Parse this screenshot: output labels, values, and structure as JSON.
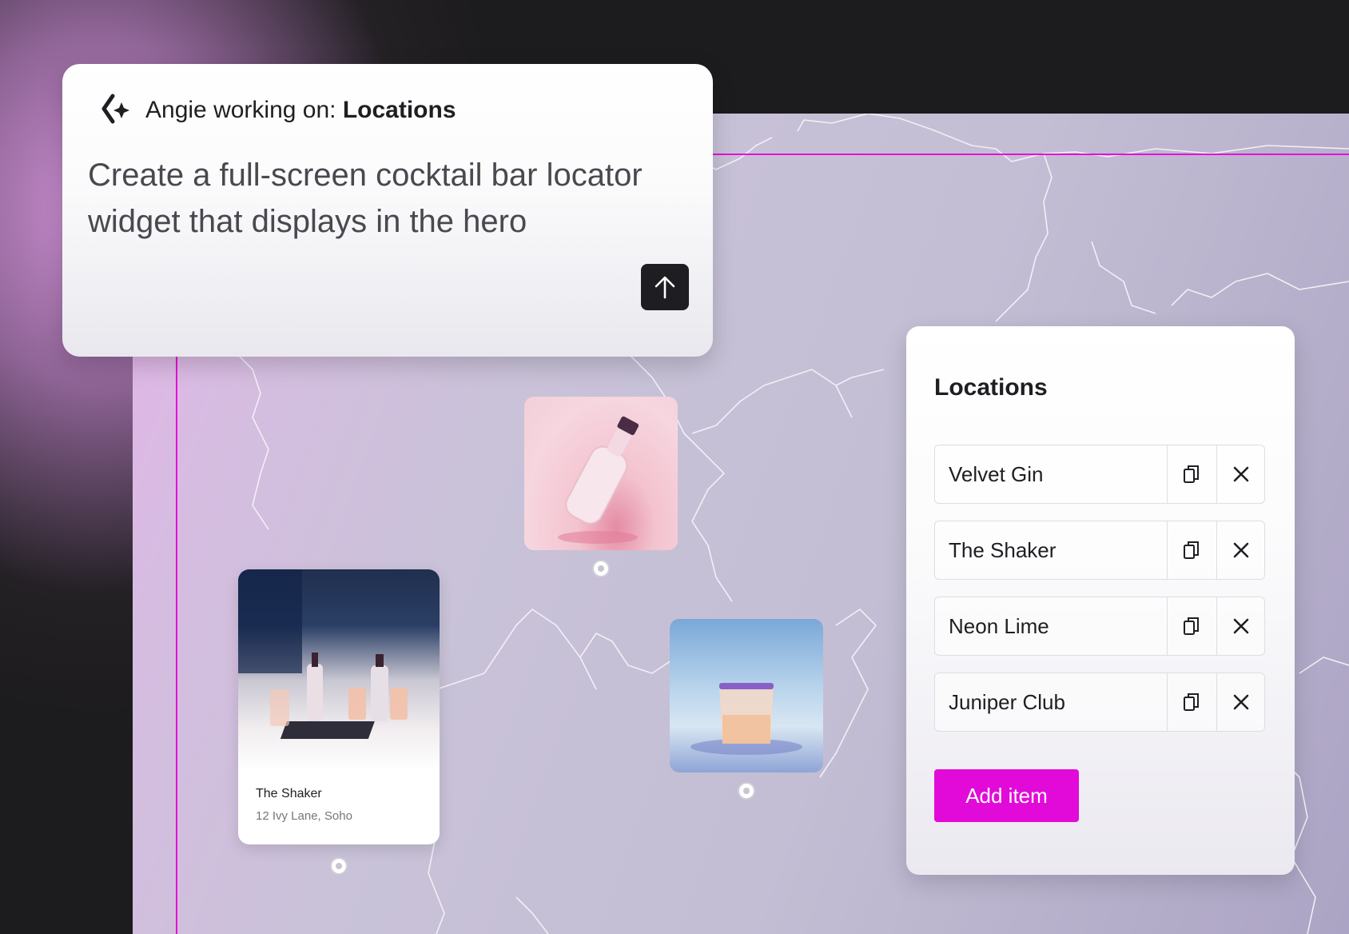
{
  "prompt": {
    "header_label": "Angie working on:",
    "header_target": "Locations",
    "text": "Create a full-screen cocktail bar locator widget that displays in the hero"
  },
  "location_card": {
    "title": "The Shaker",
    "address": "12 Ivy Lane, Soho"
  },
  "panel": {
    "title": "Locations",
    "items": [
      {
        "label": "Velvet Gin"
      },
      {
        "label": "The Shaker"
      },
      {
        "label": "Neon Lime"
      },
      {
        "label": "Juniper Club"
      }
    ],
    "add_label": "Add item"
  },
  "colors": {
    "accent": "#e20ad9",
    "guide_line": "#e311d9",
    "dark": "#1e1d21"
  },
  "icons": [
    "sparkle-icon",
    "arrow-up-icon",
    "duplicate-icon",
    "close-icon",
    "map-marker-icon"
  ]
}
